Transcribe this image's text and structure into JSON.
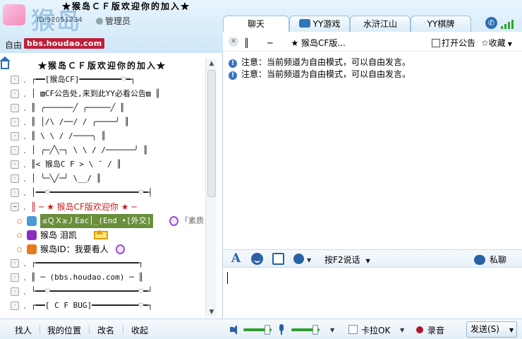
{
  "header": {
    "title": "★猴岛ＣＦ版欢迎你的加入★",
    "channel_id": "ID:52051234",
    "admin_label": "管理员",
    "mode_label": "自由",
    "site": "bbs.houdao.com",
    "logo_text": "猴岛"
  },
  "tabs": [
    {
      "label": "聊天"
    },
    {
      "label": "YY游戏"
    },
    {
      "label": "水浒江山"
    },
    {
      "label": "YY棋牌"
    }
  ],
  "channel_list": {
    "header": "★猴岛ＣＦ版欢迎你的加入★",
    "rows": [
      {
        "text": "┌━━[猴岛CF]━━━━━━━━━♡━┐"
      },
      {
        "text": "│  ▧CF公告处,来到此YY必看公告▨  ║"
      },
      {
        "text": "║      ╭──────╱ ╭─────╱  ║"
      },
      {
        "text": "║      │/\\    /──/  /  ╭────╯  ║"
      },
      {
        "text": "║        \\    \\   /  /────╮  ║"
      },
      {
        "text": "│ ╭─╱╲─╮ \\    \\  /  /──────╯  ║"
      },
      {
        "text": "║< 猴岛C F >   \\   ˘  /        ║"
      },
      {
        "text": "│ ╰─╲╱─╯         \\__/         ║"
      },
      {
        "text": "│━━♡━━━━━━━━━━━━━━━━━━━♡━┤"
      }
    ],
    "welcome": "║   ─   ★ 猴岛CF版欢迎你 ★   ─",
    "users": [
      {
        "name": "≤ＱＸ≥丿Eac│_(End •[外交]",
        "extra": "「素质"
      },
      {
        "name": "猴岛    泪凯"
      },
      {
        "name": "猴岛ID：我要看人"
      }
    ],
    "rows_after": [
      {
        "text": "┌━━━━━━━━━━━━━━━━━━━━━━┐"
      },
      {
        "text": "║   ─     (bbs.houdao.com)     ─   ║"
      },
      {
        "text": "└━━♡━━━━━━━━━━━━━━━━━━━♡━┘"
      },
      {
        "text": "┌━━[ C F  BUG]━━━━━━━━━━♡━┐"
      }
    ]
  },
  "topic_bar": {
    "t1": "║",
    "t2": "─",
    "t3": "★ 猴岛CF版...",
    "notice_label": "打开公告",
    "fav_label": "收藏"
  },
  "messages": [
    {
      "text": "注意：当前频道为自由模式，可以自由发言。"
    },
    {
      "text": "注意：当前频道为自由模式，可以自由发言。"
    }
  ],
  "compose": {
    "f2_label": "按F2说话",
    "private_label": "私聊"
  },
  "bottom": {
    "find_label": "找人",
    "location_label": "我的位置",
    "rename_label": "改名",
    "collapse_label": "收起",
    "karaoke_label": "卡拉OK",
    "record_label": "录音",
    "send_label": "发送(S)"
  },
  "levels": {
    "speaker_volume": 0.85,
    "mic_volume": 0.85
  },
  "colors": {
    "accent": "#2a60a4",
    "welcome_red": "#c81d1d",
    "site_badge": "#c0203a",
    "slider_green": "#2ca02c"
  }
}
